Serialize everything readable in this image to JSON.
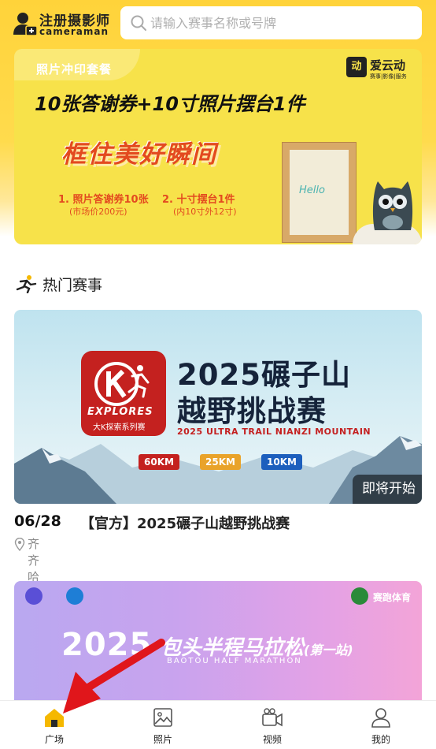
{
  "header": {
    "register_title": "注册摄影师",
    "register_subtitle": "cameraman",
    "search_placeholder": "请输入赛事名称或号牌"
  },
  "banner": {
    "label": "照片冲印套餐",
    "brand_name": "爱云动",
    "brand_logo_char": "动",
    "brand_tagline": "赛事|影像|服务",
    "headline": "10张答谢券+10寸照片摆台1件",
    "slogan": "框住美好瞬间",
    "item1_title": "1. 照片答谢券10张",
    "item1_sub": "(市场价200元)",
    "item2_title": "2. 十寸摆台1件",
    "item2_sub": "(内10寸外12寸)",
    "frame_text": "Hello"
  },
  "section": {
    "title": "热门赛事"
  },
  "event1": {
    "poster_title_line1": "2025碾子山",
    "poster_title_line2": "越野挑战赛",
    "poster_subtitle": "2025 ULTRA TRAIL NIANZI MOUNTAIN",
    "logo_text": "EXPLORES",
    "logo_subtext": "大K探索系列赛",
    "distances": [
      "60KM",
      "25KM",
      "10KM"
    ],
    "status": "即将开始",
    "date": "06/28",
    "name": "【官方】2025碾子山越野挑战赛",
    "location": "齐齐哈尔市"
  },
  "event2": {
    "poster_year": "2025",
    "poster_title": "包头半程马拉松",
    "poster_stage": "(第一站)",
    "poster_subtitle": "BAOTOU HALF MARATHON",
    "brand": "赛跑体育"
  },
  "tabbar": {
    "items": [
      {
        "label": "广场",
        "icon": "home-icon",
        "active": true
      },
      {
        "label": "照片",
        "icon": "photo-icon",
        "active": false
      },
      {
        "label": "视频",
        "icon": "video-camera-icon",
        "active": false
      },
      {
        "label": "我的",
        "icon": "user-icon",
        "active": false
      }
    ]
  },
  "colors": {
    "header_yellow": "#ffd33a",
    "accent_orange": "#f5b800",
    "poster_red": "#c4211f",
    "arrow_red": "#e0161b"
  }
}
